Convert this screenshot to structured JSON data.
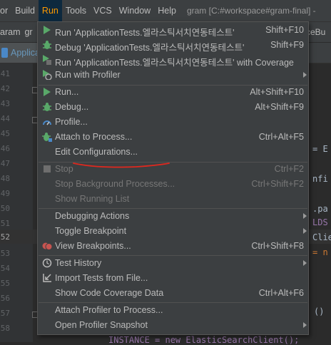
{
  "menubar": {
    "items": [
      {
        "label": "or"
      },
      {
        "label": "Build"
      },
      {
        "label": "Run"
      },
      {
        "label": "Tools"
      },
      {
        "label": "VCS"
      },
      {
        "label": "Window"
      },
      {
        "label": "Help"
      }
    ],
    "window_title": "gram [C:#workspace#gram-final] -"
  },
  "navbar": {
    "crumb1": "aram",
    "crumb2": "gr",
    "right_label": "rceBu"
  },
  "tabbar": {
    "active_tab": "Applica"
  },
  "gutter": {
    "line_numbers": [
      "41",
      "42",
      "43",
      "44",
      "45",
      "46",
      "47",
      "48",
      "49",
      "50",
      "51",
      "52",
      "53",
      "54",
      "55",
      "56",
      "57",
      "58"
    ],
    "current_line": "52"
  },
  "code_fragments": {
    "f1": "= E",
    "f2": "nfi",
    "f3": ".pa",
    "f4": "LDS",
    "f5": "Clie",
    "f6": "= n",
    "f7": "()",
    "f8": "INSTANCE = new ElasticSearchClient();"
  },
  "run_menu": {
    "items": [
      {
        "label": "Run 'ApplicationTests.엘라스틱서치연동테스트'",
        "shortcut": "Shift+F10",
        "icon": "run-icon"
      },
      {
        "label": "Debug 'ApplicationTests.엘라스틱서치연동테스트'",
        "shortcut": "Shift+F9",
        "icon": "debug-icon"
      },
      {
        "label": "Run 'ApplicationTests.엘라스틱서치연동테스트' with Coverage",
        "shortcut": "",
        "icon": "coverage-icon"
      },
      {
        "label": "Run with Profiler",
        "shortcut": "",
        "icon": "profiler-icon",
        "submenu": true
      },
      {
        "label": "Run...",
        "shortcut": "Alt+Shift+F10",
        "icon": "run-icon"
      },
      {
        "label": "Debug...",
        "shortcut": "Alt+Shift+F9",
        "icon": "debug-icon"
      },
      {
        "label": "Profile...",
        "shortcut": "",
        "icon": "profile-gauge-icon"
      },
      {
        "label": "Attach to Process...",
        "shortcut": "Ctrl+Alt+F5",
        "icon": "attach-debug-icon"
      },
      {
        "label": "Edit Configurations...",
        "shortcut": "",
        "icon": ""
      },
      {
        "label": "Stop",
        "shortcut": "Ctrl+F2",
        "icon": "stop-icon",
        "disabled": true
      },
      {
        "label": "Stop Background Processes...",
        "shortcut": "Ctrl+Shift+F2",
        "icon": "",
        "disabled": true
      },
      {
        "label": "Show Running List",
        "shortcut": "",
        "icon": "",
        "disabled": true
      },
      {
        "label": "Debugging Actions",
        "shortcut": "",
        "icon": "",
        "submenu": true
      },
      {
        "label": "Toggle Breakpoint",
        "shortcut": "",
        "icon": "",
        "submenu": true
      },
      {
        "label": "View Breakpoints...",
        "shortcut": "Ctrl+Shift+F8",
        "icon": "breakpoints-icon"
      },
      {
        "label": "Test History",
        "shortcut": "",
        "icon": "history-clock-icon",
        "submenu": true
      },
      {
        "label": "Import Tests from File...",
        "shortcut": "",
        "icon": "import-tests-icon"
      },
      {
        "label": "Show Code Coverage Data",
        "shortcut": "Ctrl+Alt+F6",
        "icon": ""
      },
      {
        "label": "Attach Profiler to Process...",
        "shortcut": "",
        "icon": ""
      },
      {
        "label": "Open Profiler Snapshot",
        "shortcut": "",
        "icon": "",
        "submenu": true
      }
    ]
  },
  "colors": {
    "run_green": "#59a869",
    "accent_orange": "#ff9900",
    "annotation_red": "#e0281e"
  }
}
